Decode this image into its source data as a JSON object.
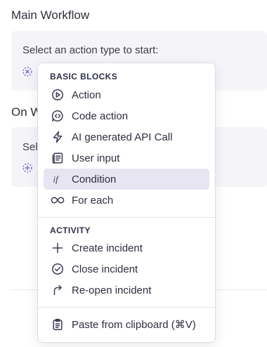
{
  "main_workflow": {
    "title": "Main Workflow",
    "prompt": "Select an action type to start:"
  },
  "on_section": {
    "title_visible": "On W",
    "prompt_visible": "Sel"
  },
  "menu": {
    "basic_blocks": {
      "heading": "BASIC BLOCKS",
      "items": [
        {
          "label": "Action",
          "icon": "play-circle-icon"
        },
        {
          "label": "Code action",
          "icon": "code-bubble-icon"
        },
        {
          "label": "AI generated API Call",
          "icon": "lightning-icon"
        },
        {
          "label": "User input",
          "icon": "form-icon"
        },
        {
          "label": "Condition",
          "icon": "if-icon"
        },
        {
          "label": "For each",
          "icon": "loop-icon"
        }
      ]
    },
    "activity": {
      "heading": "ACTIVITY",
      "items": [
        {
          "label": "Create incident",
          "icon": "plus-icon"
        },
        {
          "label": "Close incident",
          "icon": "check-circle-icon"
        },
        {
          "label": "Re-open incident",
          "icon": "reopen-arrow-icon"
        }
      ]
    },
    "paste": {
      "label": "Paste from clipboard (⌘V)",
      "icon": "clipboard-icon"
    },
    "highlighted_item": "Condition"
  },
  "colors": {
    "card_bg": "#f5f5f9",
    "highlight_bg": "#e7e5f1",
    "dashed_icon": "#6b5fd0"
  }
}
